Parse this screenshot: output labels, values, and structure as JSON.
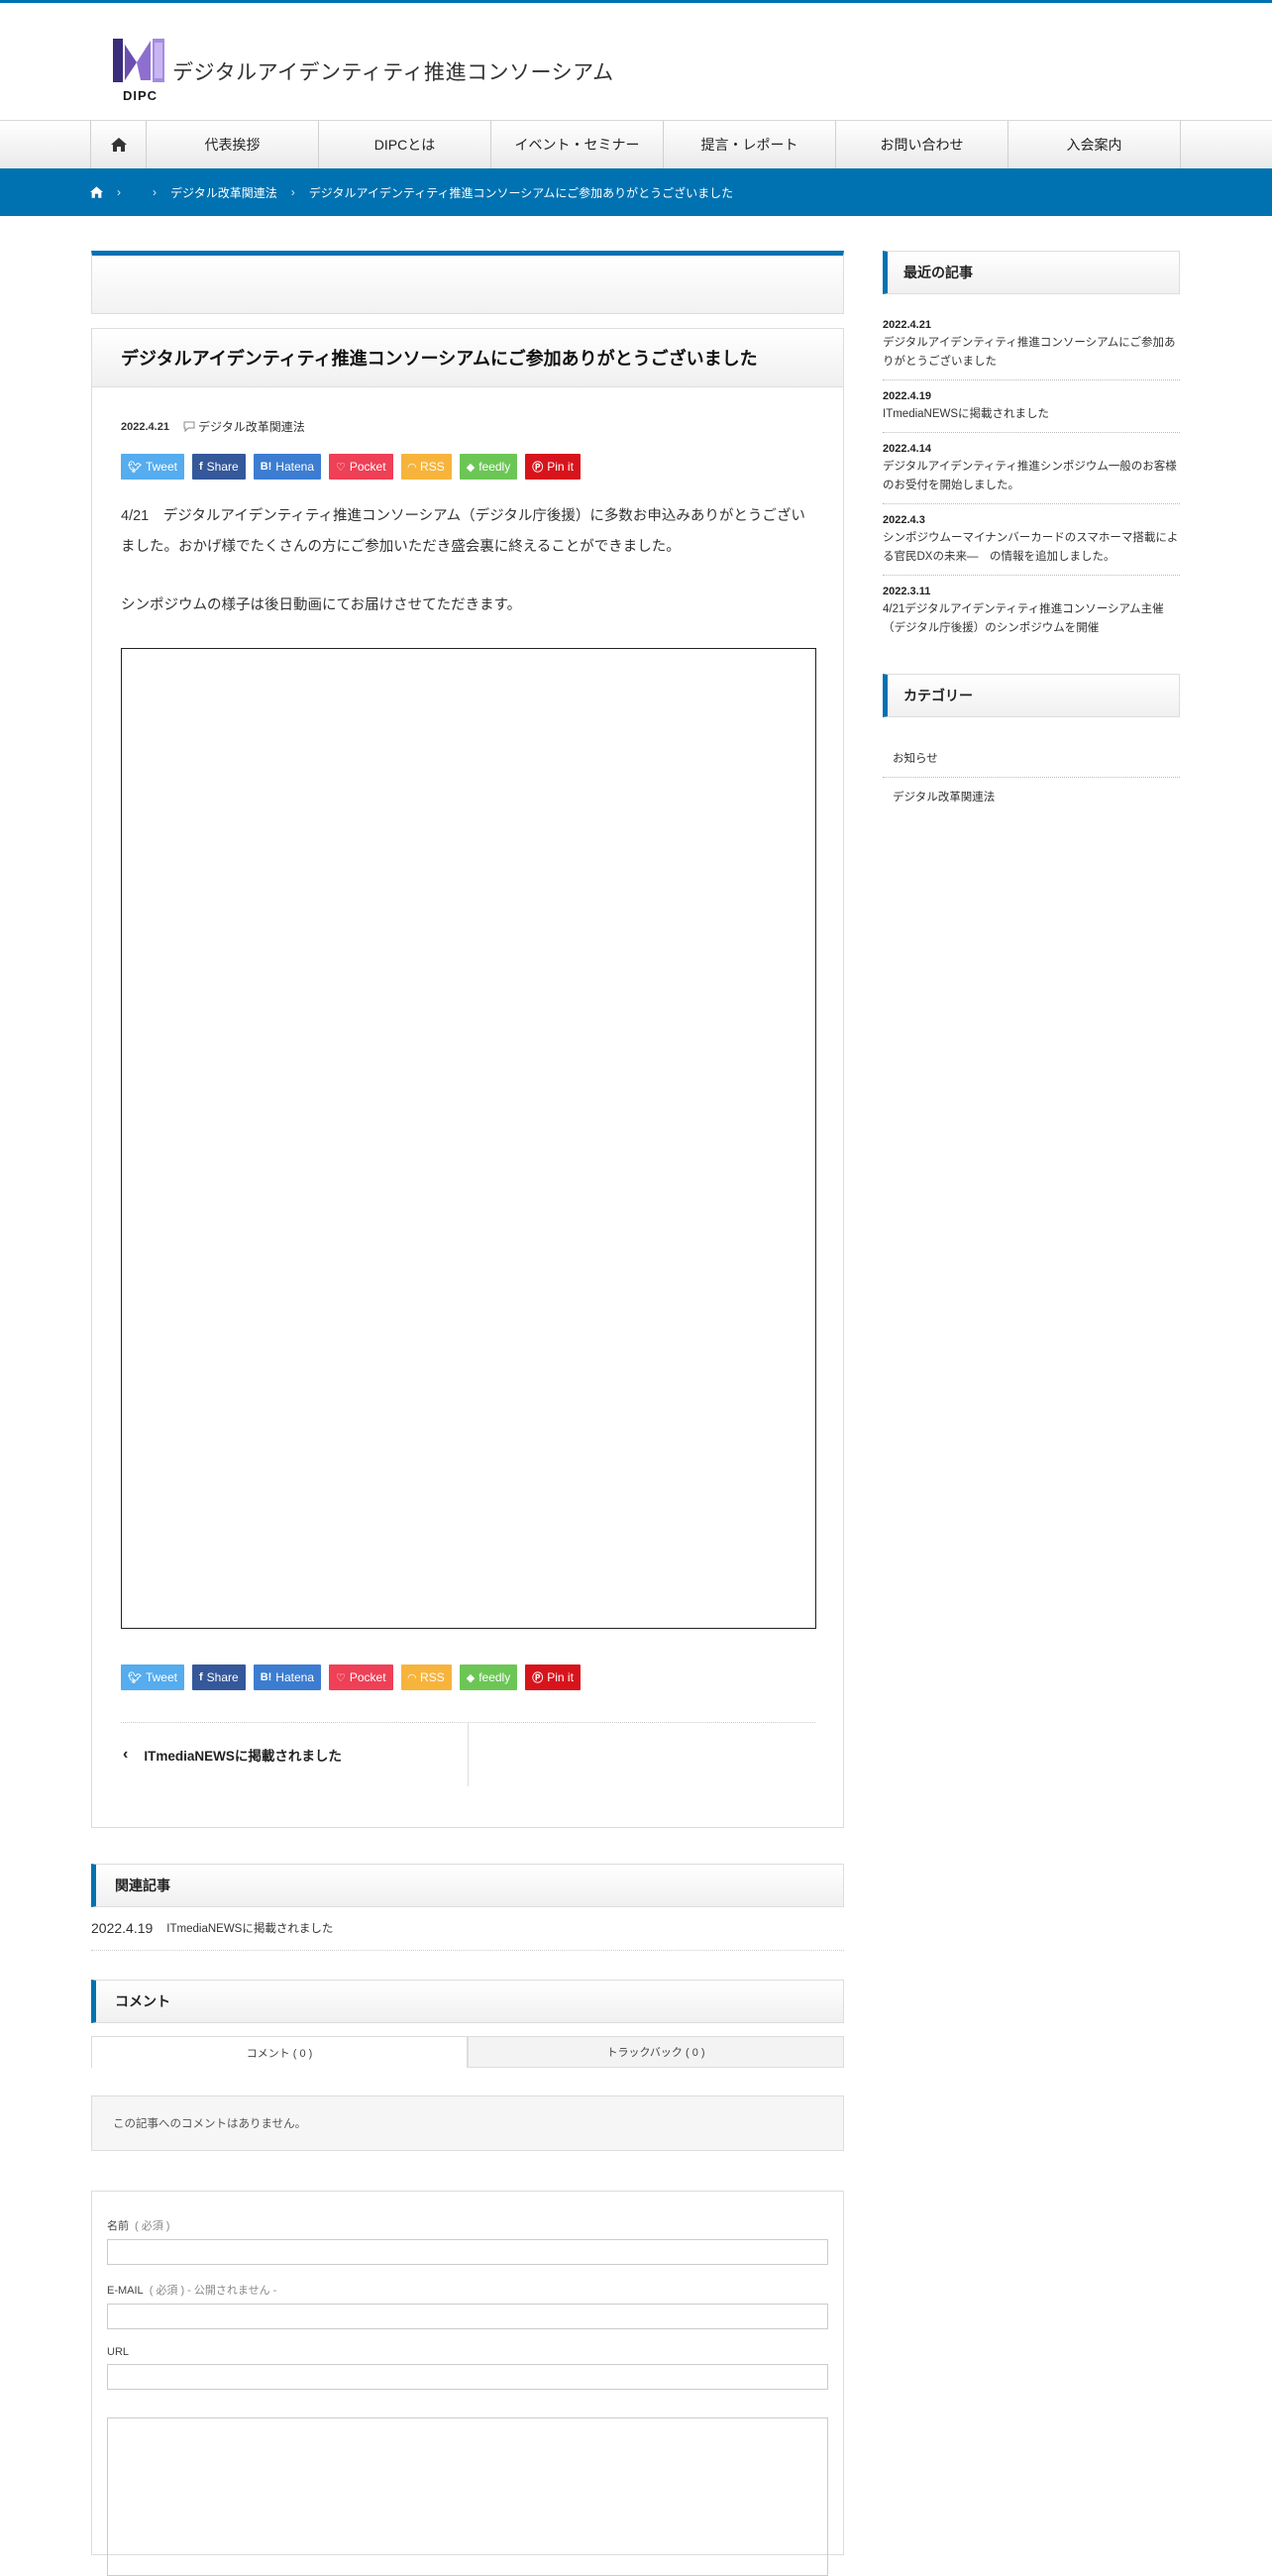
{
  "header": {
    "logo_abbr": "DIPC",
    "site_name": "デジタルアイデンティティ推進コンソーシアム"
  },
  "nav": {
    "items": [
      {
        "label": "代表挨拶"
      },
      {
        "label": "DIPCとは"
      },
      {
        "label": "イベント・セミナー"
      },
      {
        "label": "提言・レポート"
      },
      {
        "label": "お問い合わせ"
      },
      {
        "label": "入会案内"
      }
    ]
  },
  "breadcrumb": {
    "category": "デジタル改革関連法",
    "current": "デジタルアイデンティティ推進コンソーシアムにご参加ありがとうございました"
  },
  "post": {
    "title": "デジタルアイデンティティ推進コンソーシアムにご参加ありがとうございました",
    "date": "2022.4.21",
    "category": "デジタル改革関連法",
    "paragraph1": "4/21　デジタルアイデンティティ推進コンソーシアム（デジタル庁後援）に多数お申込みありがとうございました。おかげ様でたくさんの方にご参加いただき盛会裏に終えることができました。",
    "paragraph2": "シンポジウムの様子は後日動画にてお届けさせてただきます。",
    "prev_link": "ITmediaNEWSに掲載されました"
  },
  "share": {
    "tweet": "Tweet",
    "share": "Share",
    "hatena": "Hatena",
    "pocket": "Pocket",
    "rss": "RSS",
    "feedly": "feedly",
    "pin": "Pin it"
  },
  "related": {
    "heading": "関連記事",
    "items": [
      {
        "date": "2022.4.19",
        "title": "ITmediaNEWSに掲載されました"
      }
    ]
  },
  "comments": {
    "heading": "コメント",
    "tab_comments": "コメント ( 0 )",
    "tab_trackbacks": "トラックバック ( 0 )",
    "empty_text": "この記事へのコメントはありません。",
    "name_label": "名前",
    "name_req": "( 必須 )",
    "email_label": "E-MAIL",
    "email_req": "( 必須 ) - 公開されません -",
    "url_label": "URL"
  },
  "sidebar": {
    "recent_heading": "最近の記事",
    "recent": [
      {
        "date": "2022.4.21",
        "title": "デジタルアイデンティティ推進コンソーシアムにご参加ありがとうございました"
      },
      {
        "date": "2022.4.19",
        "title": "ITmediaNEWSに掲載されました"
      },
      {
        "date": "2022.4.14",
        "title": "デジタルアイデンティティ推進シンポジウム一般のお客様のお受付を開始しました。"
      },
      {
        "date": "2022.4.3",
        "title": "シンポジウムーマイナンバーカードのスマホーマ搭載による官民DXの未来—　の情報を追加しました。"
      },
      {
        "date": "2022.3.11",
        "title": "4/21デジタルアイデンティティ推進コンソーシアム主催（デジタル庁後援）のシンポジウムを開催"
      }
    ],
    "category_heading": "カテゴリー",
    "categories": [
      {
        "label": "お知らせ"
      },
      {
        "label": "デジタル改革関連法"
      }
    ]
  },
  "colors": {
    "accent": "#0072b2",
    "tweet": "#55acee",
    "facebook": "#35589a",
    "hatena": "#3c7dd1",
    "pocket": "#ee4056",
    "rss": "#f7b43c",
    "feedly": "#6cc655",
    "pinterest": "#d7141c"
  },
  "icons": {
    "home": "home-icon",
    "category": "comment-bubble-icon",
    "prev": "chevron-left-icon"
  }
}
